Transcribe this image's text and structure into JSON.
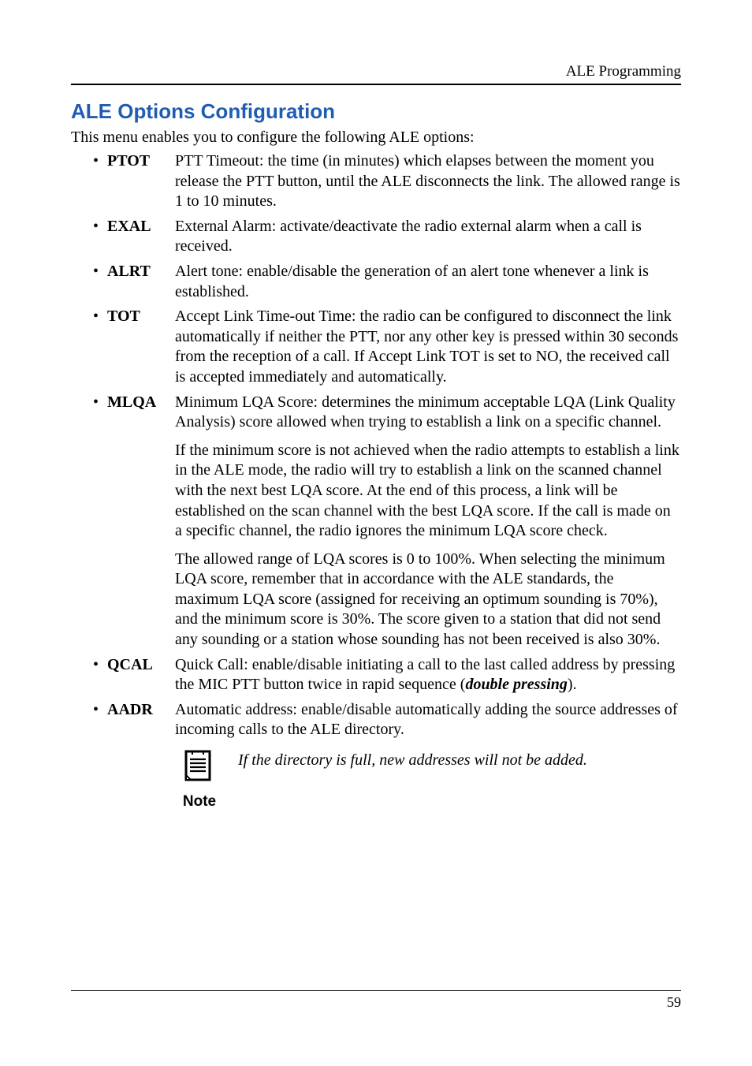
{
  "header": {
    "right_text": "ALE Programming"
  },
  "section_title": "ALE Options Configuration",
  "intro_text": "This menu enables you to configure the following ALE options:",
  "options": {
    "ptot": {
      "term": "PTOT",
      "desc": "PTT Timeout: the time (in minutes) which elapses between the moment you release the PTT button, until the ALE disconnects the link. The allowed range is 1 to 10 minutes."
    },
    "exal": {
      "term": "EXAL",
      "desc": "External Alarm: activate/deactivate the radio external alarm when a call is received."
    },
    "alrt": {
      "term": "ALRT",
      "desc": "Alert tone: enable/disable the generation of an alert tone whenever a link is established."
    },
    "tot": {
      "term": "TOT",
      "desc": "Accept Link Time-out Time: the radio can be configured to disconnect the link automatically if neither the PTT, nor any other key is pressed within 30 seconds from the reception of a call. If Accept Link TOT is set to NO, the received call is accepted immediately and automatically."
    },
    "mlqa": {
      "term": "MLQA",
      "p1": "Minimum LQA Score: determines the minimum acceptable LQA (Link Quality Analysis) score allowed when trying to establish a link on a specific channel.",
      "p2": "If the minimum score is not achieved when the radio attempts to establish a link in the ALE mode, the radio will try to establish a link on the scanned channel with the next best LQA score. At the end of this process, a link will be established on the scan channel with the best LQA score. If the call is made on a specific channel, the radio ignores the minimum LQA score check.",
      "p3": "The allowed range of LQA scores is 0 to 100%. When selecting the minimum LQA score, remember that in accordance with the ALE standards, the maximum LQA score (assigned for receiving an optimum sounding is 70%), and the minimum score is 30%. The score given to a station that did not send any sounding or a station whose sounding has not been received is also 30%."
    },
    "qcal": {
      "term": "QCAL",
      "prefix": "Quick Call: enable/disable initiating a call to the last called address by pressing the MIC PTT button twice in rapid sequence (",
      "emph": "double pressing",
      "suffix": ")."
    },
    "aadr": {
      "term": "AADR",
      "desc": "Automatic address: enable/disable automatically adding the source addresses of incoming calls to the ALE directory.",
      "note_label": "Note",
      "note_text": "If the directory is full, new addresses will not be added."
    }
  },
  "footer": {
    "page_number": "59"
  }
}
